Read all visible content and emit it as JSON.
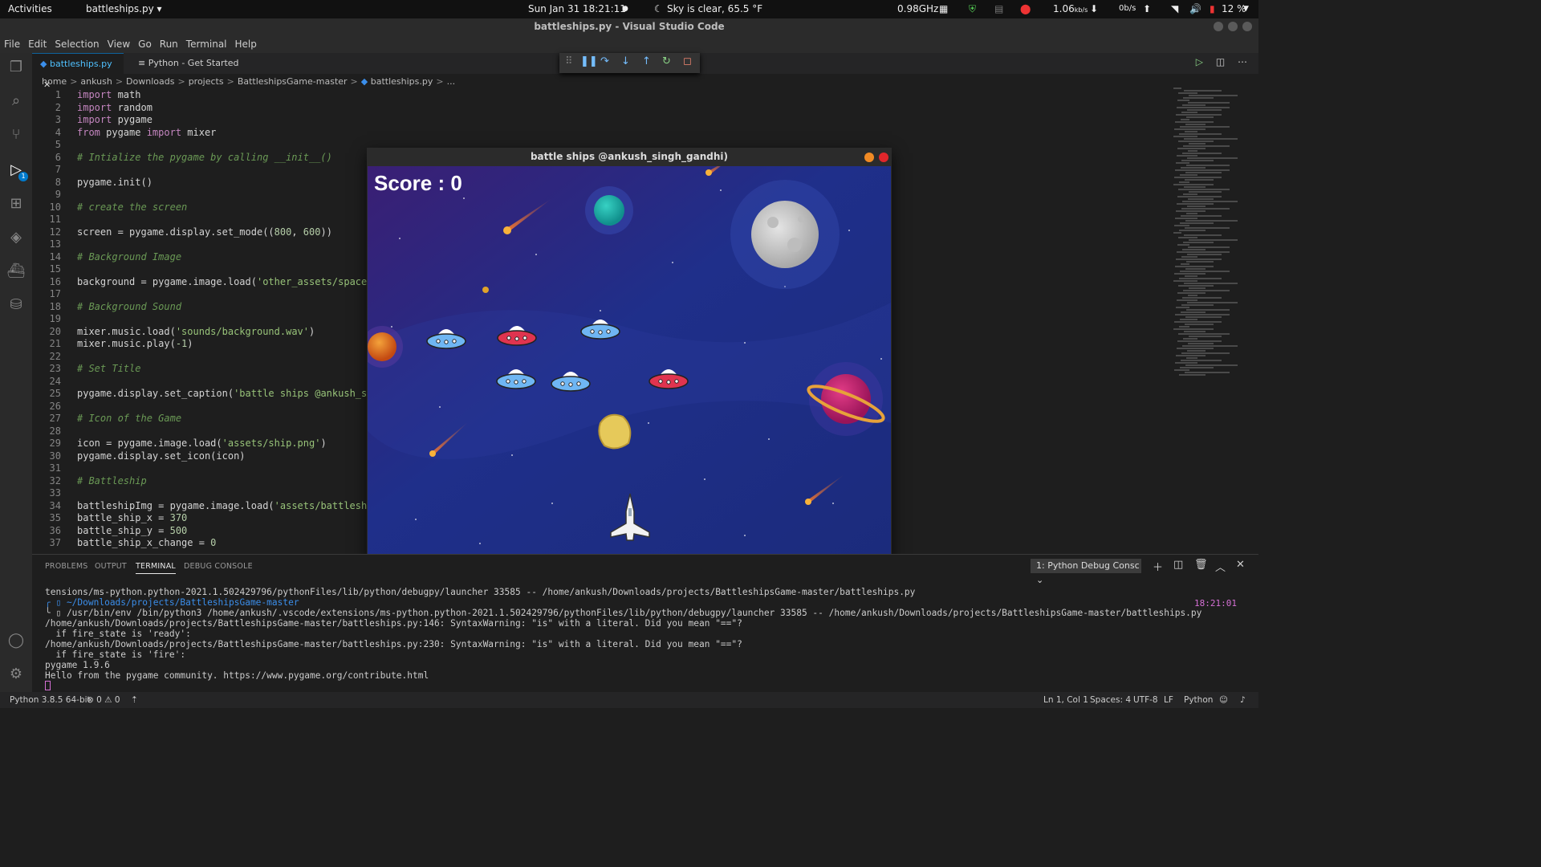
{
  "topbar": {
    "activities": "Activities",
    "app_menu": "battleships.py ▾",
    "clock": "Sun Jan 31  18:21:11",
    "weather": "Sky is clear, 65.5 °F",
    "cpu": "0.98GHz",
    "net_down": "1.06",
    "net_down_unit": "kb/s",
    "net_up": "0b/s",
    "battery": "12 %"
  },
  "window": {
    "title": "battleships.py - Visual Studio Code"
  },
  "menu": [
    "File",
    "Edit",
    "Selection",
    "View",
    "Go",
    "Run",
    "Terminal",
    "Help"
  ],
  "activity_badge": "1",
  "tabs": [
    {
      "label": "battleships.py"
    },
    {
      "label": "Python - Get Started"
    }
  ],
  "breadcrumb": [
    "home",
    "ankush",
    "Downloads",
    "projects",
    "BattleshipsGame-master",
    "battleships.py",
    "..."
  ],
  "code_lines": [
    {
      "n": "1",
      "t": "import math"
    },
    {
      "n": "2",
      "t": "import random"
    },
    {
      "n": "3",
      "t": "import pygame"
    },
    {
      "n": "4",
      "t": "from pygame import mixer"
    },
    {
      "n": "5",
      "t": ""
    },
    {
      "n": "6",
      "t": "# Intialize the pygame by calling __init__()"
    },
    {
      "n": "7",
      "t": ""
    },
    {
      "n": "8",
      "t": "pygame.init()"
    },
    {
      "n": "9",
      "t": ""
    },
    {
      "n": "10",
      "t": "# create the screen"
    },
    {
      "n": "11",
      "t": ""
    },
    {
      "n": "12",
      "t": "screen = pygame.display.set_mode((800, 600))"
    },
    {
      "n": "13",
      "t": ""
    },
    {
      "n": "14",
      "t": "# Background Image"
    },
    {
      "n": "15",
      "t": ""
    },
    {
      "n": "16",
      "t": "background = pygame.image.load('other_assets/space.pr"
    },
    {
      "n": "17",
      "t": ""
    },
    {
      "n": "18",
      "t": "# Background Sound"
    },
    {
      "n": "19",
      "t": ""
    },
    {
      "n": "20",
      "t": "mixer.music.load('sounds/background.wav')"
    },
    {
      "n": "21",
      "t": "mixer.music.play(-1)"
    },
    {
      "n": "22",
      "t": ""
    },
    {
      "n": "23",
      "t": "# Set Title"
    },
    {
      "n": "24",
      "t": ""
    },
    {
      "n": "25",
      "t": "pygame.display.set_caption('battle ships @ankush_sing"
    },
    {
      "n": "26",
      "t": ""
    },
    {
      "n": "27",
      "t": "# Icon of the Game"
    },
    {
      "n": "28",
      "t": ""
    },
    {
      "n": "29",
      "t": "icon = pygame.image.load('assets/ship.png')"
    },
    {
      "n": "30",
      "t": "pygame.display.set_icon(icon)"
    },
    {
      "n": "31",
      "t": ""
    },
    {
      "n": "32",
      "t": "# Battleship"
    },
    {
      "n": "33",
      "t": ""
    },
    {
      "n": "34",
      "t": "battleshipImg = pygame.image.load('assets/battleship."
    },
    {
      "n": "35",
      "t": "battle_ship_x = 370"
    },
    {
      "n": "36",
      "t": "battle_ship_y = 500"
    },
    {
      "n": "37",
      "t": "battle_ship_x_change = 0"
    }
  ],
  "game": {
    "title": "battle ships @ankush_singh_gandhi)",
    "score_text": "Score : 0"
  },
  "panel": {
    "tabs": [
      "PROBLEMS",
      "OUTPUT",
      "TERMINAL",
      "DEBUG CONSOLE"
    ],
    "terminal_select": "1: Python Debug Consc",
    "time": "18:21:01",
    "terminal_lines": [
      "tensions/ms-python.python-2021.1.502429796/pythonFiles/lib/python/debugpy/launcher 33585 -- /home/ankush/Downloads/projects/BattleshipsGame-master/battleships.py",
      "╭ ▯ ~/Downloads/projects/BattleshipsGame-master",
      "╰ ▯ /usr/bin/env /bin/python3 /home/ankush/.vscode/extensions/ms-python.python-2021.1.502429796/pythonFiles/lib/python/debugpy/launcher 33585 -- /home/ankush/Downloads/projects/BattleshipsGame-master/battleships.py",
      "/home/ankush/Downloads/projects/BattleshipsGame-master/battleships.py:146: SyntaxWarning: \"is\" with a literal. Did you mean \"==\"?",
      "  if fire_state is 'ready':",
      "/home/ankush/Downloads/projects/BattleshipsGame-master/battleships.py:230: SyntaxWarning: \"is\" with a literal. Did you mean \"==\"?",
      "  if fire_state is 'fire':",
      "pygame 1.9.6",
      "Hello from the pygame community. https://www.pygame.org/contribute.html"
    ]
  },
  "status": {
    "python": "Python 3.8.5 64-bit",
    "errors": "⊗ 0 ⚠ 0",
    "position": "Ln 1, Col 1",
    "spaces": "Spaces: 4",
    "encoding": "UTF-8",
    "eol": "LF",
    "language": "Python"
  },
  "colors": {
    "accent": "#007acc",
    "keyword": "#c586c0",
    "string": "#ce9178",
    "comment": "#6a9955"
  }
}
